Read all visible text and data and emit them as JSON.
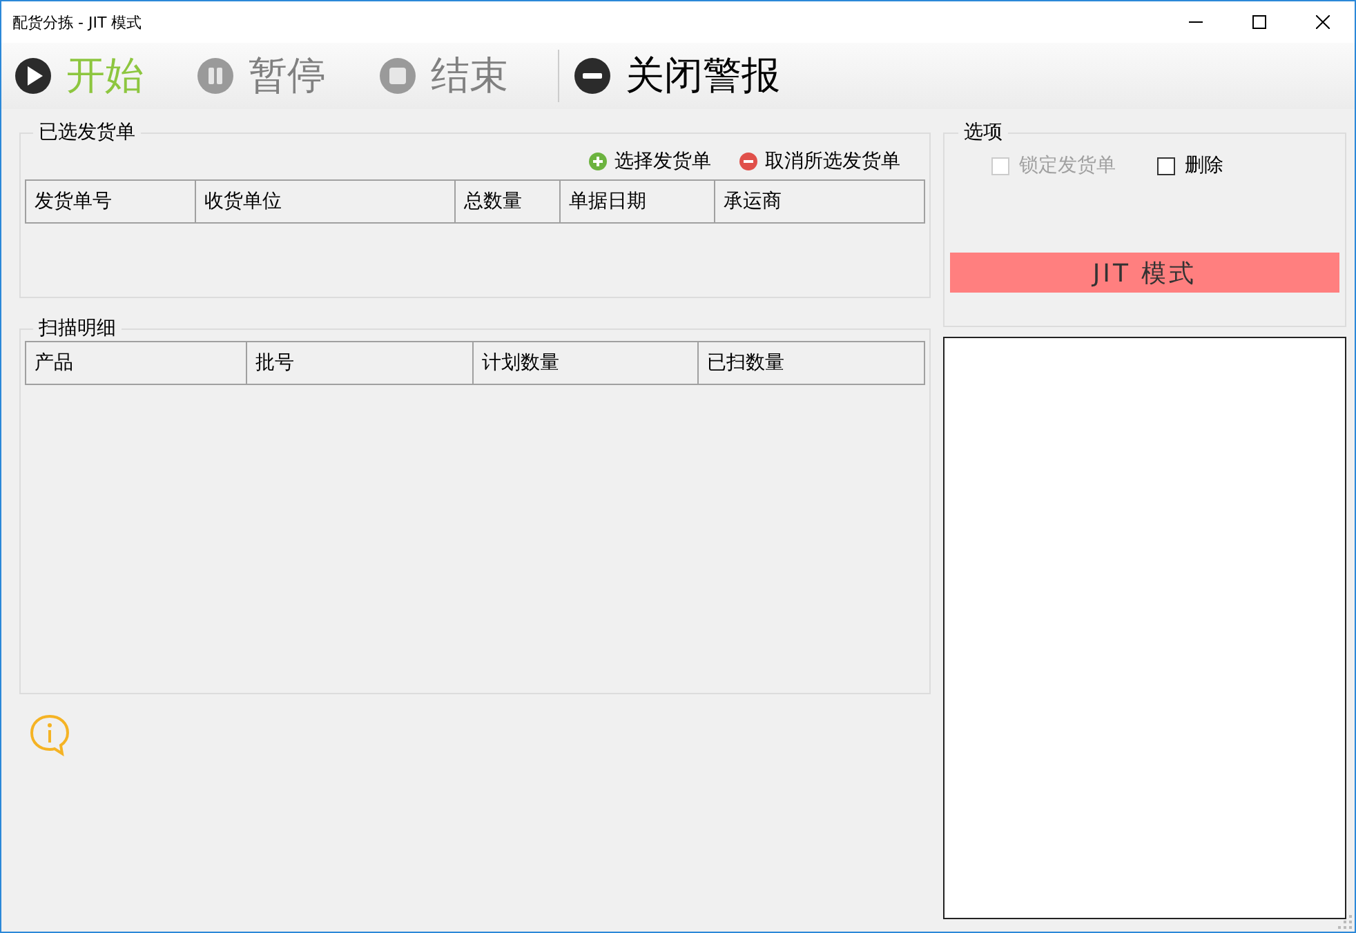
{
  "window": {
    "title": "配货分拣 - JIT 模式"
  },
  "toolbar": [
    {
      "label": "开始",
      "kind": "play",
      "disabled": false
    },
    {
      "label": "暂停",
      "kind": "pause",
      "disabled": true
    },
    {
      "label": "结束",
      "kind": "stop",
      "disabled": true
    },
    {
      "label": "关闭警报",
      "kind": "minus",
      "disabled": false
    }
  ],
  "orders_group": {
    "title": "已选发货单",
    "actions": [
      {
        "label": "选择发货单",
        "kind": "add"
      },
      {
        "label": "取消所选发货单",
        "kind": "remove"
      }
    ],
    "columns": [
      "发货单号",
      "收货单位",
      "总数量",
      "单据日期",
      "承运商"
    ]
  },
  "scan_group": {
    "title": "扫描明细",
    "columns": [
      "产品",
      "批号",
      "计划数量",
      "已扫数量"
    ]
  },
  "options": {
    "title": "选项",
    "checkboxes": [
      {
        "label": "锁定发货单",
        "checked": false,
        "disabled": true
      },
      {
        "label": "删除",
        "checked": false,
        "disabled": false
      }
    ],
    "mode_banner": "JIT 模式"
  }
}
